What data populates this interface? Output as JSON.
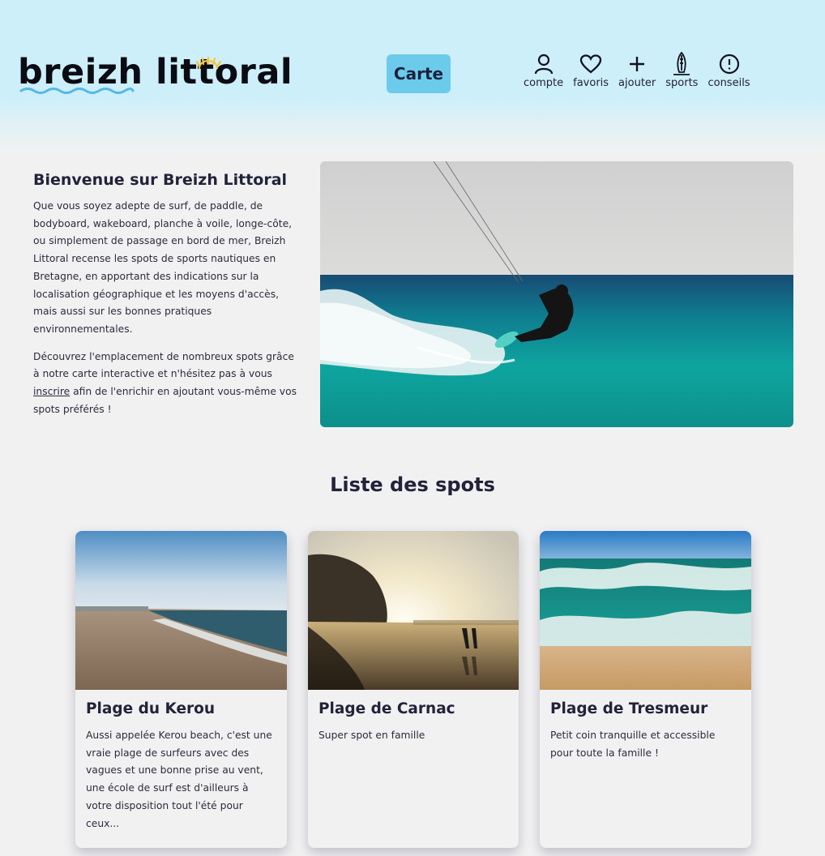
{
  "header": {
    "logo_text": "breizh littoral",
    "map_button": "Carte",
    "nav": [
      {
        "label": "compte",
        "icon": "user-icon"
      },
      {
        "label": "favoris",
        "icon": "heart-icon"
      },
      {
        "label": "ajouter",
        "icon": "plus-icon"
      },
      {
        "label": "sports",
        "icon": "surfboard-icon"
      },
      {
        "label": "conseils",
        "icon": "alert-circle-icon"
      }
    ]
  },
  "intro": {
    "title": "Bienvenue sur Breizh Littoral",
    "paragraph1": "Que vous soyez adepte de surf, de paddle, de bodyboard, wakeboard, planche à voile, longe-côte, ou simplement de passage en bord de mer, Breizh Littoral recense les spots de sports nautiques en Bretagne, en apportant des indications sur la localisation géographique et les moyens d'accès, mais aussi sur les bonnes pratiques environnementales.",
    "paragraph2_start": "Découvrez l'emplacement de nombreux spots grâce à notre carte interactive et n'hésitez pas à vous ",
    "signup_link": "inscrire",
    "paragraph2_end": " afin de l'enrichir en ajoutant vous-même vos spots préférés !"
  },
  "spots": {
    "title": "Liste des spots",
    "items": [
      {
        "name": "Plage du Kerou",
        "description": "Aussi appelée Kerou beach, c'est une vraie plage de surfeurs avec des vagues et une bonne prise au vent, une école de surf est d'ailleurs à votre disposition tout l'été pour ceux..."
      },
      {
        "name": "Plage de Carnac",
        "description": "Super spot en famille"
      },
      {
        "name": "Plage de Tresmeur",
        "description": "Petit coin tranquille et accessible pour toute la famille !"
      }
    ]
  },
  "colors": {
    "header_bg": "#cdeff9",
    "accent": "#6ccbeb",
    "text": "#22223a",
    "page_bg": "#f1f1f2"
  }
}
